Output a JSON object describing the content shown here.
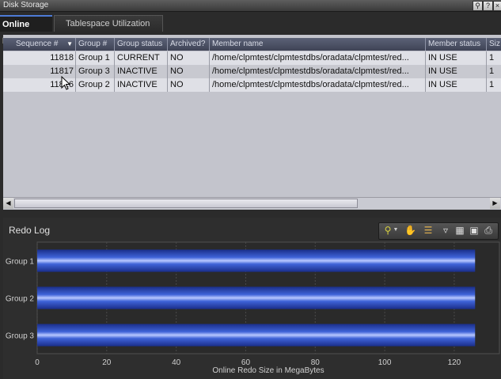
{
  "window": {
    "title": "Disk Storage"
  },
  "tabs": [
    {
      "label": "Online Redo",
      "active": true
    },
    {
      "label": "Tablespace Utilization",
      "active": false
    }
  ],
  "table": {
    "columns": [
      "Sequence #",
      "Group #",
      "Group status",
      "Archived?",
      "Member name",
      "Member status",
      "Siz"
    ],
    "rows": [
      {
        "sequence": "11818",
        "group": "Group 1",
        "status": "CURRENT",
        "archived": "NO",
        "member": "/home/clpmtest/clpmtestdbs/oradata/clpmtest/red...",
        "member_status": "IN USE",
        "size": "1"
      },
      {
        "sequence": "11817",
        "group": "Group 3",
        "status": "INACTIVE",
        "archived": "NO",
        "member": "/home/clpmtest/clpmtestdbs/oradata/clpmtest/red...",
        "member_status": "IN USE",
        "size": "1"
      },
      {
        "sequence": "11816",
        "group": "Group 2",
        "status": "INACTIVE",
        "archived": "NO",
        "member": "/home/clpmtest/clpmtestdbs/oradata/clpmtest/red...",
        "member_status": "IN USE",
        "size": "1"
      }
    ]
  },
  "chart_panel": {
    "title": "Redo Log",
    "toolbar_icons": [
      "zoom-icon",
      "pan-hand-icon",
      "legend-icon",
      "filter-icon",
      "table-view-icon",
      "save-icon",
      "print-icon"
    ]
  },
  "chart_data": {
    "type": "bar",
    "orientation": "horizontal",
    "categories": [
      "Group 1",
      "Group 2",
      "Group 3"
    ],
    "values": [
      126,
      126,
      126
    ],
    "xlabel": "Online Redo Size in MegaBytes",
    "ylabel": "",
    "xlim": [
      0,
      133
    ],
    "xticks": [
      0,
      20,
      40,
      60,
      80,
      100,
      120
    ],
    "grid": true,
    "bar_color": "#3f63d8"
  }
}
